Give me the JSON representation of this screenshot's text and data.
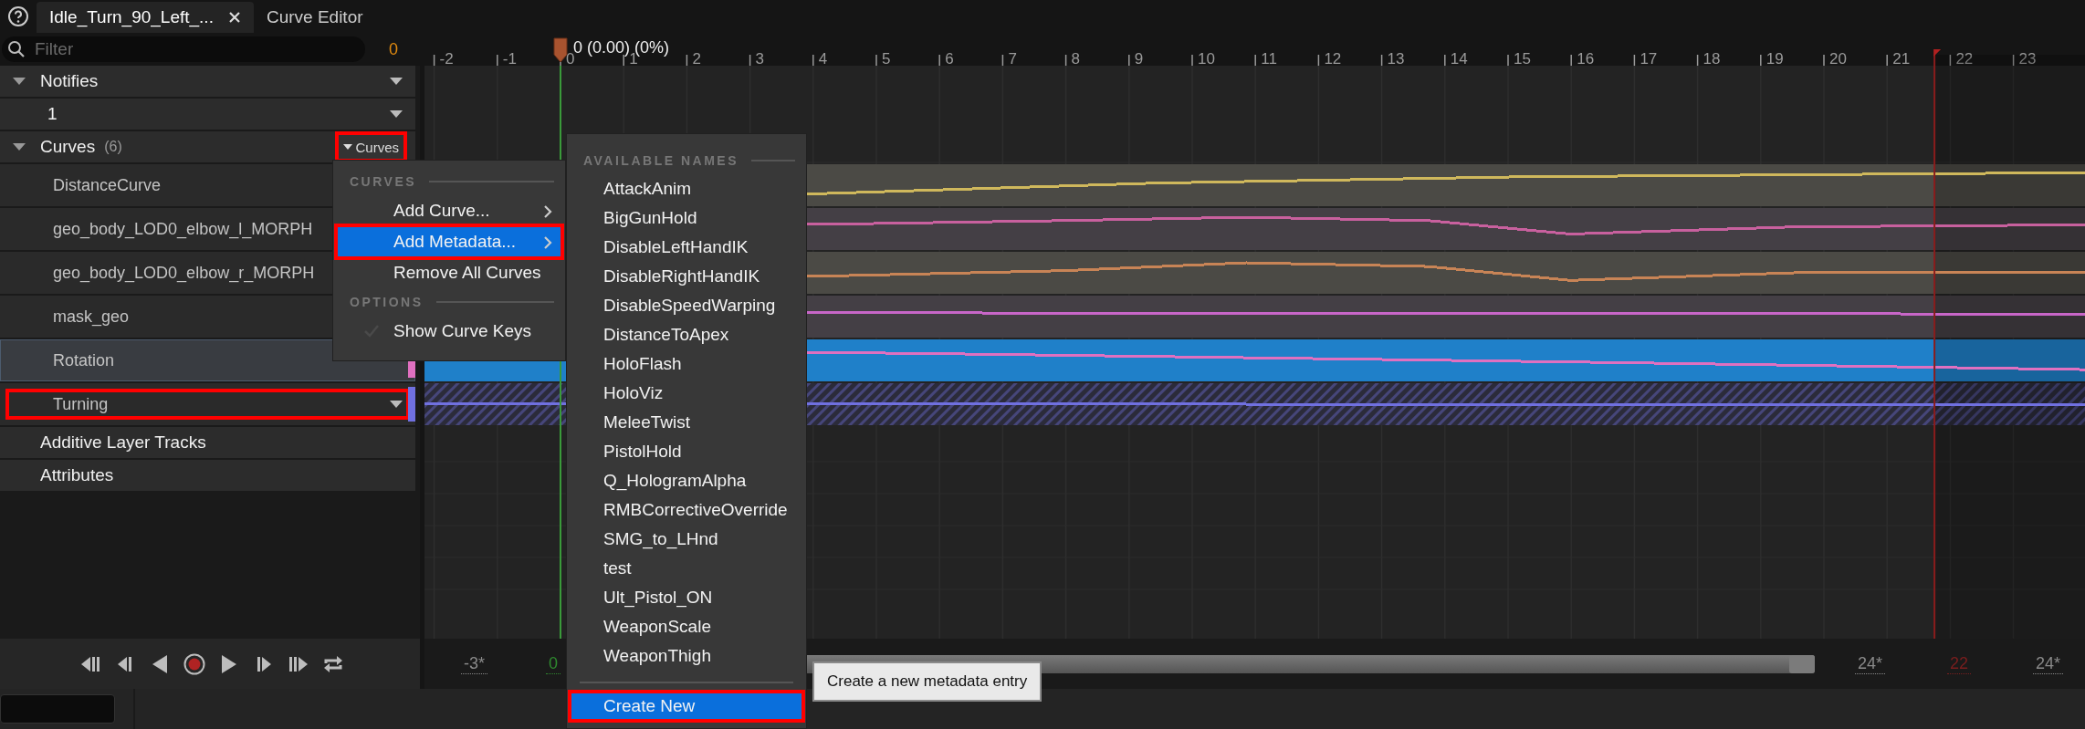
{
  "tabs": [
    {
      "label": "Idle_Turn_90_Left_...",
      "selected": true,
      "closable": true
    },
    {
      "label": "Curve Editor",
      "selected": false,
      "closable": false
    }
  ],
  "filter": {
    "placeholder": "Filter",
    "count": "0"
  },
  "tracks": [
    {
      "label": "Notifies",
      "expanded": true,
      "dropdown": true,
      "children": [
        {
          "label": "1",
          "dropdown": true
        }
      ]
    },
    {
      "label": "Curves",
      "count": "(6)",
      "expanded": true,
      "button": {
        "label": "Curves",
        "highlighted": true
      },
      "children": [
        {
          "label": "DistanceCurve",
          "kind": "float",
          "selected": false,
          "highlighted": false,
          "dropdown": false,
          "color": "#cfb85c"
        },
        {
          "label": "geo_body_LOD0_elbow_l_MORPH",
          "kind": "float",
          "selected": false,
          "highlighted": false,
          "dropdown": false,
          "color": "#c8609e"
        },
        {
          "label": "geo_body_LOD0_elbow_r_MORPH",
          "kind": "float",
          "selected": false,
          "highlighted": false,
          "dropdown": false,
          "color": "#c88456"
        },
        {
          "label": "mask_geo",
          "kind": "float",
          "selected": false,
          "highlighted": false,
          "dropdown": false,
          "color": "#c866c8"
        },
        {
          "label": "Rotation",
          "kind": "float",
          "selected": true,
          "highlighted": false,
          "dropdown": false,
          "color": "#e070c0"
        },
        {
          "label": "Turning",
          "kind": "metadata",
          "selected": false,
          "highlighted": true,
          "dropdown": true,
          "color": "#7070e0"
        }
      ]
    },
    {
      "label": "Additive Layer Tracks"
    },
    {
      "label": "Attributes"
    }
  ],
  "timeline": {
    "ticks": [
      "-2",
      "-1",
      "0",
      "1",
      "2",
      "3",
      "4",
      "5",
      "6",
      "7",
      "8",
      "9",
      "10",
      "11",
      "12",
      "13",
      "14",
      "15",
      "16",
      "17",
      "18",
      "19",
      "20",
      "21",
      "22",
      "23"
    ],
    "playhead": "0 (0.00) (0%)"
  },
  "range": [
    {
      "text": "-3*",
      "kind": "bound"
    },
    {
      "text": "0",
      "kind": "current"
    },
    {
      "text": "24*",
      "kind": "bound"
    },
    {
      "text": "22",
      "kind": "end"
    },
    {
      "text": "24*",
      "kind": "bound"
    }
  ],
  "curves_menu": {
    "sections": [
      {
        "header": "CURVES",
        "items": [
          {
            "label": "Add Curve...",
            "kind": "submenu",
            "selected": false,
            "highlighted": false
          },
          {
            "label": "Add Metadata...",
            "kind": "submenu",
            "selected": true,
            "highlighted": true
          },
          {
            "label": "Remove All Curves",
            "kind": "action",
            "selected": false,
            "highlighted": false
          }
        ]
      },
      {
        "header": "OPTIONS",
        "items": [
          {
            "label": "Show Curve Keys",
            "kind": "check",
            "checked": false,
            "selected": false,
            "highlighted": false
          }
        ]
      }
    ]
  },
  "names_menu": {
    "header": "AVAILABLE NAMES",
    "names": [
      {
        "label": "AttackAnim",
        "selected": false
      },
      {
        "label": "BigGunHold",
        "selected": false
      },
      {
        "label": "DisableLeftHandIK",
        "selected": false
      },
      {
        "label": "DisableRightHandIK",
        "selected": false
      },
      {
        "label": "DisableSpeedWarping",
        "selected": false
      },
      {
        "label": "DistanceToApex",
        "selected": false
      },
      {
        "label": "HoloFlash",
        "selected": false
      },
      {
        "label": "HoloViz",
        "selected": false
      },
      {
        "label": "MeleeTwist",
        "selected": false
      },
      {
        "label": "PistolHold",
        "selected": false
      },
      {
        "label": "Q_HologramAlpha",
        "selected": false
      },
      {
        "label": "RMBCorrectiveOverride",
        "selected": false
      },
      {
        "label": "SMG_to_LHnd",
        "selected": false
      },
      {
        "label": "test",
        "selected": false
      },
      {
        "label": "Ult_Pistol_ON",
        "selected": false
      },
      {
        "label": "WeaponScale",
        "selected": false
      },
      {
        "label": "WeaponThigh",
        "selected": false
      }
    ],
    "create": {
      "label": "Create New",
      "selected": true,
      "highlighted": true
    }
  },
  "tooltip": "Create a new metadata entry"
}
